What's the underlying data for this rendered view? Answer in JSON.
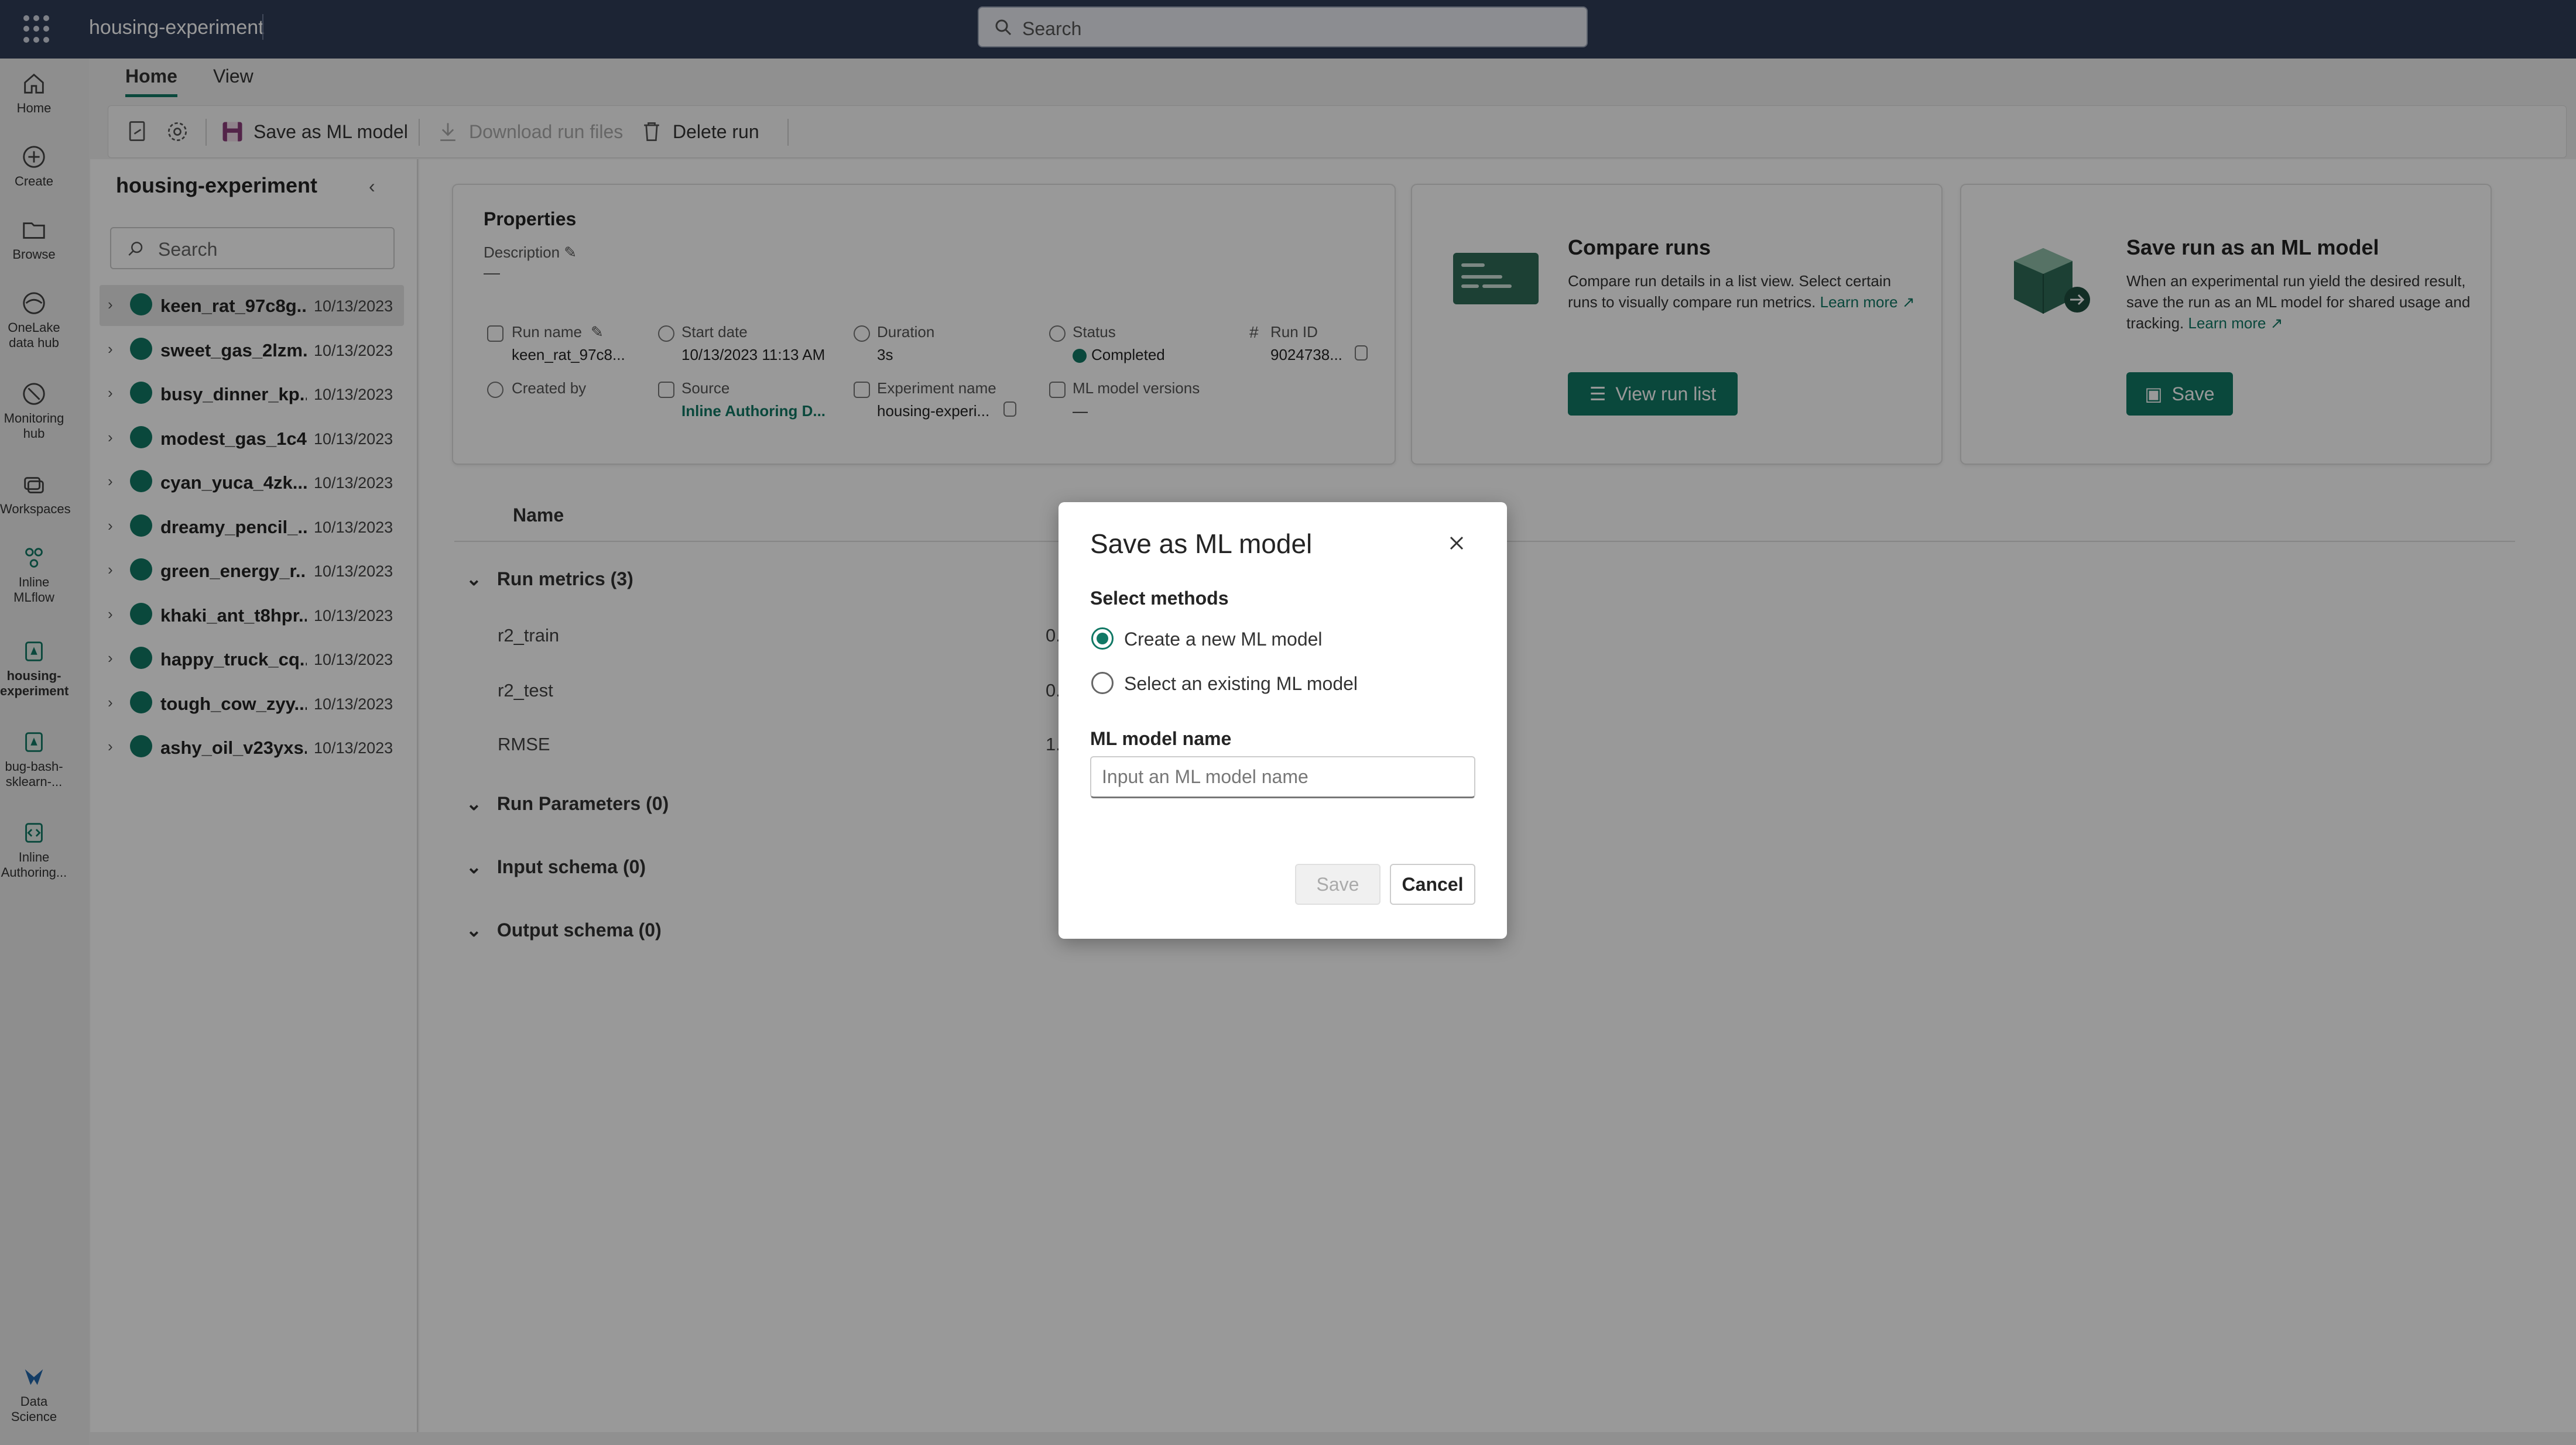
{
  "app": {
    "title": "housing-experiment",
    "search_placeholder": "Search"
  },
  "rail": {
    "items": [
      {
        "label": "Home",
        "icon": "home-icon"
      },
      {
        "label": "Create",
        "icon": "plus-circle-icon"
      },
      {
        "label": "Browse",
        "icon": "folder-icon"
      },
      {
        "label": "OneLake data hub",
        "icon": "onelake-icon"
      },
      {
        "label": "Monitoring hub",
        "icon": "monitoring-icon"
      },
      {
        "label": "Workspaces",
        "icon": "workspaces-icon"
      },
      {
        "label": "Inline MLflow",
        "icon": "mlflow-icon"
      },
      {
        "label": "housing-experiment",
        "icon": "experiment-icon"
      },
      {
        "label": "bug-bash-sklearn-...",
        "icon": "experiment-icon"
      },
      {
        "label": "Inline Authoring...",
        "icon": "code-icon"
      }
    ],
    "bottom_label": "Data Science"
  },
  "tabs": [
    {
      "label": "Home"
    },
    {
      "label": "View"
    }
  ],
  "toolbar": {
    "save_model": "Save as ML model",
    "download": "Download run files",
    "delete": "Delete run"
  },
  "sidebar": {
    "title": "housing-experiment",
    "search_placeholder": "Search",
    "runs": [
      {
        "name": "keen_rat_97c8g...",
        "date": "10/13/2023"
      },
      {
        "name": "sweet_gas_2lzm...",
        "date": "10/13/2023"
      },
      {
        "name": "busy_dinner_kp...",
        "date": "10/13/2023"
      },
      {
        "name": "modest_gas_1c4...",
        "date": "10/13/2023"
      },
      {
        "name": "cyan_yuca_4zk...",
        "date": "10/13/2023"
      },
      {
        "name": "dreamy_pencil_...",
        "date": "10/13/2023"
      },
      {
        "name": "green_energy_r...",
        "date": "10/13/2023"
      },
      {
        "name": "khaki_ant_t8hpr...",
        "date": "10/13/2023"
      },
      {
        "name": "happy_truck_cq...",
        "date": "10/13/2023"
      },
      {
        "name": "tough_cow_zyy...",
        "date": "10/13/2023"
      },
      {
        "name": "ashy_oil_v23yxs...",
        "date": "10/13/2023"
      }
    ]
  },
  "properties": {
    "title": "Properties",
    "description_label": "Description",
    "description_value": "—",
    "run_name_label": "Run name",
    "run_name": "keen_rat_97c8...",
    "start_date_label": "Start date",
    "start_date": "10/13/2023 11:13 AM",
    "duration_label": "Duration",
    "duration": "3s",
    "status_label": "Status",
    "status": "Completed",
    "run_id_label": "Run ID",
    "run_id": "9024738...",
    "created_by_label": "Created by",
    "source_label": "Source",
    "source": "Inline Authoring D...",
    "experiment_label": "Experiment name",
    "experiment": "housing-experi...",
    "ml_versions_label": "ML model versions",
    "ml_versions": "—"
  },
  "compare": {
    "title": "Compare runs",
    "text": "Compare run details in a list view. Select certain runs to visually compare run metrics.",
    "learn_more": "Learn more",
    "button": "View run list"
  },
  "save_card": {
    "title": "Save run as an ML model",
    "text": "When an experimental run yield the desired result, save the run as an ML model for shared usage and tracking.",
    "learn_more": "Learn more",
    "button": "Save"
  },
  "table": {
    "name_header": "Name",
    "run_metrics": "Run metrics (3)",
    "metrics": [
      {
        "name": "r2_train",
        "value": "0."
      },
      {
        "name": "r2_test",
        "value": "0."
      },
      {
        "name": "RMSE",
        "value": "1."
      }
    ],
    "run_params": "Run Parameters (0)",
    "input_schema": "Input schema (0)",
    "output_schema": "Output schema (0)"
  },
  "dialog": {
    "title": "Save as ML model",
    "methods_label": "Select methods",
    "option_new": "Create a new ML model",
    "option_existing": "Select an existing ML model",
    "name_label": "ML model name",
    "name_placeholder": "Input an ML model name",
    "save": "Save",
    "cancel": "Cancel"
  },
  "colors": {
    "accent": "#117865",
    "topbar": "#2f3c58"
  }
}
